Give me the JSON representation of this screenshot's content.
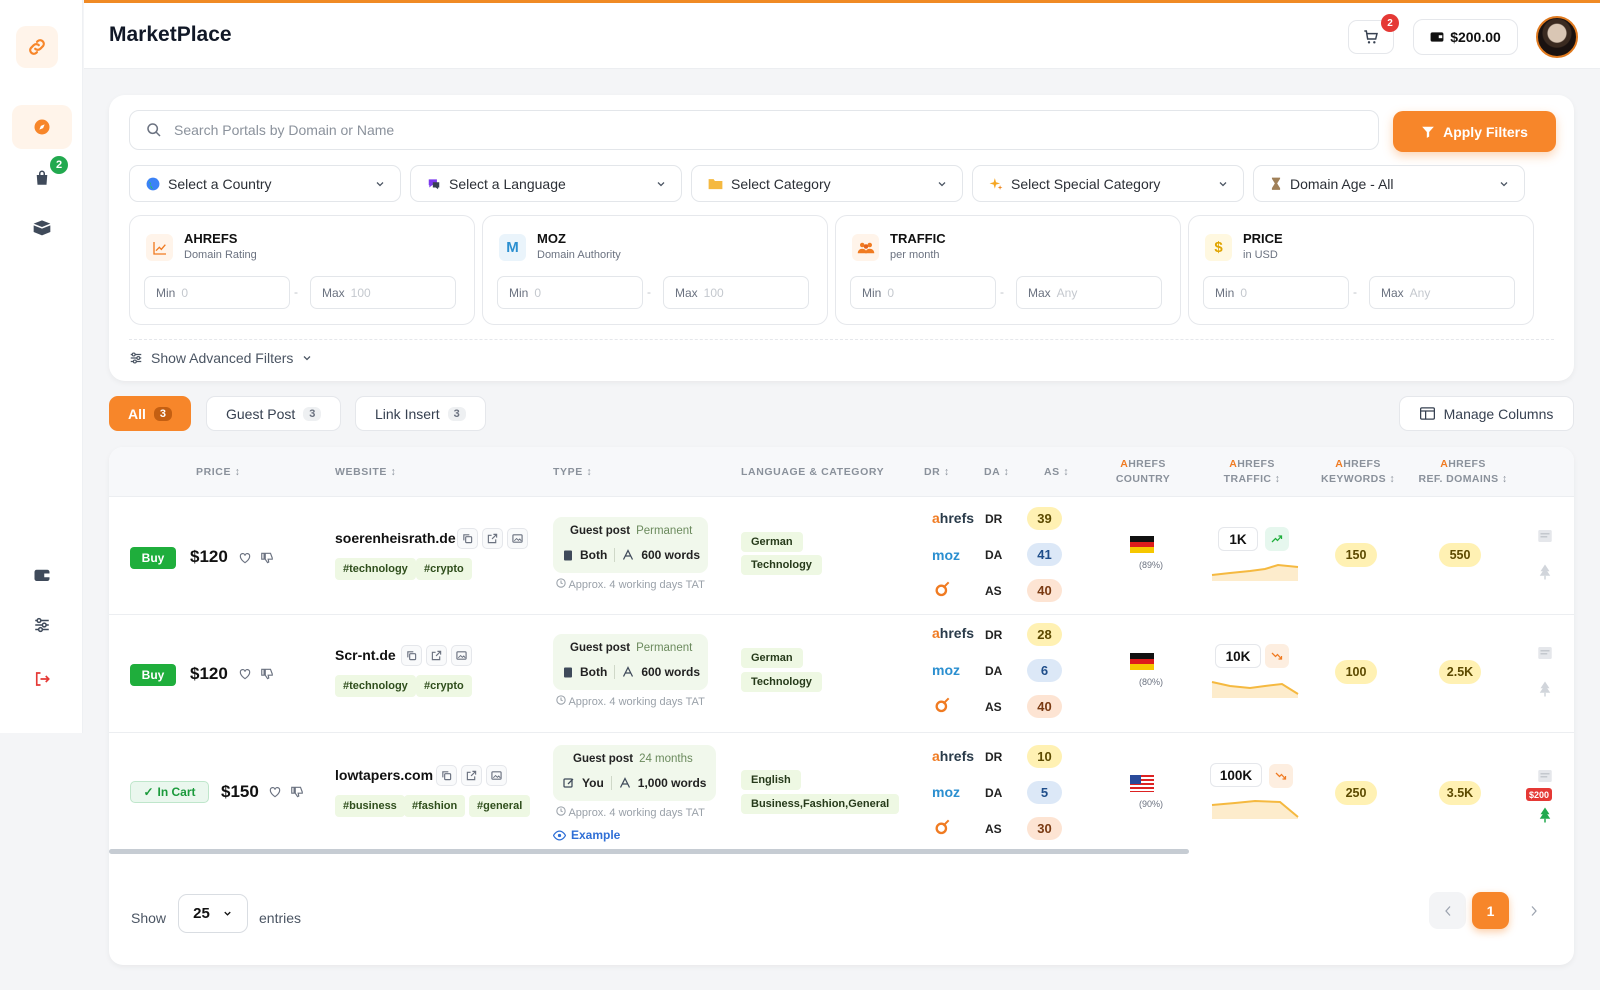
{
  "app": {
    "title": "MarketPlace"
  },
  "header": {
    "cart_count": "2",
    "balance": "$200.00"
  },
  "sidebar": {
    "orders_badge": "2"
  },
  "search": {
    "placeholder": "Search Portals by Domain or Name",
    "apply_label": "Apply Filters"
  },
  "filters": {
    "country": "Select a Country",
    "language": "Select a Language",
    "category": "Select Category",
    "special": "Select Special Category",
    "domain_age": "Domain Age - All",
    "advanced": "Show Advanced Filters"
  },
  "metrics": [
    {
      "title": "AHREFS",
      "sub": "Domain Rating",
      "min_label": "Min",
      "min_ph": "0",
      "max_label": "Max",
      "max_ph": "100",
      "icon": "chart-line-icon"
    },
    {
      "title": "MOZ",
      "sub": "Domain Authority",
      "min_label": "Min",
      "min_ph": "0",
      "max_label": "Max",
      "max_ph": "100",
      "icon": "moz-m-icon"
    },
    {
      "title": "TRAFFIC",
      "sub": "per month",
      "min_label": "Min",
      "min_ph": "0",
      "max_label": "Max",
      "max_ph": "Any",
      "icon": "users-icon"
    },
    {
      "title": "PRICE",
      "sub": "in USD",
      "min_label": "Min",
      "min_ph": "0",
      "max_label": "Max",
      "max_ph": "Any",
      "icon": "dollar-icon"
    }
  ],
  "tabs": [
    {
      "label": "All",
      "count": "3"
    },
    {
      "label": "Guest Post",
      "count": "3"
    },
    {
      "label": "Link Insert",
      "count": "3"
    }
  ],
  "manage_columns": "Manage Columns",
  "columns": {
    "price": "PRICE ↕",
    "website": "WEBSITE ↕",
    "type": "TYPE ↕",
    "lang": "LANGUAGE & CATEGORY",
    "dr": "DR ↕",
    "da": "DA ↕",
    "as": "AS ↕",
    "a_country_1": "A",
    "a_country_2": "HREFS",
    "a_country_3": "COUNTRY",
    "a_traffic_1": "A",
    "a_traffic_2": "HREFS",
    "a_traffic_3": "TRAFFIC ↕",
    "a_keywords_1": "A",
    "a_keywords_2": "HREFS",
    "a_keywords_3": "KEYWORDS ↕",
    "a_ref_1": "A",
    "a_ref_2": "HREFS",
    "a_ref_3": "REF. DOMAINS ↕"
  },
  "metric_logos": {
    "ahrefs_a": "a",
    "ahrefs_rest": "hrefs",
    "moz": "moz",
    "dr": "DR",
    "da": "DA",
    "as": "AS"
  },
  "rows": [
    {
      "action": "Buy",
      "price": "$120",
      "website": "soerenheisrath.de",
      "tags": [
        "#technology",
        "#crypto"
      ],
      "type": "Guest post",
      "duration": "Permanent",
      "who": "Both",
      "words": "600 words",
      "tat": "Approx. 4 working days TAT",
      "language": "German",
      "category": "Technology",
      "dr": "39",
      "da": "41",
      "as": "40",
      "country_pct": "(89%)",
      "traffic": "1K",
      "keywords": "150",
      "ref_domains": "550"
    },
    {
      "action": "Buy",
      "price": "$120",
      "website": "Scr-nt.de",
      "tags": [
        "#technology",
        "#crypto"
      ],
      "type": "Guest post",
      "duration": "Permanent",
      "who": "Both",
      "words": "600 words",
      "tat": "Approx. 4 working days TAT",
      "language": "German",
      "category": "Technology",
      "dr": "28",
      "da": "6",
      "as": "40",
      "country_pct": "(80%)",
      "traffic": "10K",
      "keywords": "100",
      "ref_domains": "2.5K"
    },
    {
      "action": "In Cart",
      "price": "$150",
      "website": "lowtapers.com",
      "tags": [
        "#business",
        "#fashion",
        "#general"
      ],
      "type": "Guest post",
      "duration": "24 months",
      "who": "You",
      "words": "1,000 words",
      "tat": "Approx. 4 working days TAT",
      "example": "Example",
      "language": "English",
      "category": "Business,Fashion,General",
      "dr": "10",
      "da": "5",
      "as": "30",
      "country_pct": "(90%)",
      "traffic": "100K",
      "keywords": "250",
      "ref_domains": "3.5K",
      "side_price": "$200"
    }
  ],
  "pagination": {
    "show": "Show",
    "per_page": "25",
    "entries": "entries",
    "current": "1"
  },
  "colors": {
    "accent": "#f7862a",
    "buy": "#1fae3c",
    "dr_pill": "#fff1b3",
    "da_pill": "#dce8f7",
    "as_pill": "#fde4d3"
  }
}
